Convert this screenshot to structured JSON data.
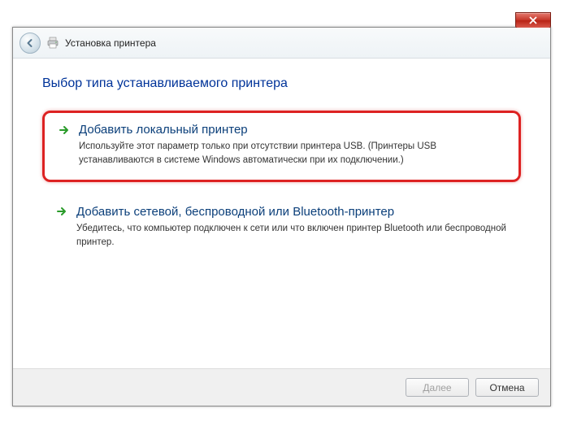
{
  "titlebar": {
    "text": "Установка принтера"
  },
  "page": {
    "title": "Выбор типа устанавливаемого принтера"
  },
  "options": [
    {
      "title": "Добавить локальный принтер",
      "description": "Используйте этот параметр только при отсутствии принтера USB. (Принтеры USB устанавливаются в системе Windows автоматически при их подключении.)"
    },
    {
      "title": "Добавить сетевой, беспроводной или Bluetooth-принтер",
      "description": "Убедитесь, что компьютер подключен к сети или что включен принтер Bluetooth или беспроводной принтер."
    }
  ],
  "buttons": {
    "next": "Далее",
    "cancel": "Отмена"
  }
}
